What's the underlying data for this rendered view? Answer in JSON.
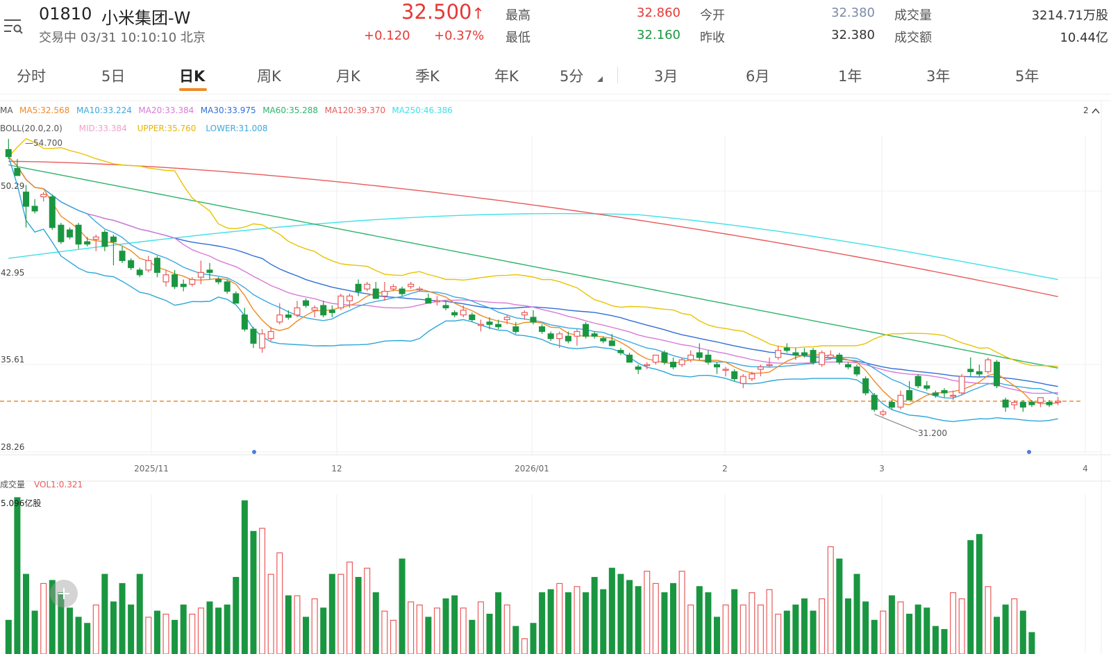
{
  "stock": {
    "code": "01810",
    "name": "小米集团-W",
    "status": "交易中 03/31 10:10:10 北京",
    "price": "32.500",
    "arrow": "↑",
    "change": "+0.120",
    "change_pct": "+0.37%"
  },
  "quote": [
    {
      "label": "最高",
      "value": "32.860",
      "color": "#e53935"
    },
    {
      "label": "最低",
      "value": "32.160",
      "color": "#1a9641"
    },
    {
      "label": "今开",
      "value": "32.380",
      "color": "#7a8aa8"
    },
    {
      "label": "昨收",
      "value": "32.380",
      "color": "#333333"
    },
    {
      "label": "成交量",
      "value": "3214.71万股",
      "color": "#333333"
    },
    {
      "label": "成交额",
      "value": "10.44亿",
      "color": "#333333"
    }
  ],
  "tabs": [
    "分时",
    "5日",
    "日K",
    "周K",
    "月K",
    "季K",
    "年K",
    "5分",
    "3月",
    "6月",
    "1年",
    "3年",
    "5年"
  ],
  "active_tab": "日K",
  "indicators": {
    "ma": [
      {
        "text": "MA",
        "color": "#555555"
      },
      {
        "text": "MA5:32.568",
        "color": "#f08a24"
      },
      {
        "text": "MA10:33.224",
        "color": "#3aa8e0"
      },
      {
        "text": "MA20:33.384",
        "color": "#d77ad8"
      },
      {
        "text": "MA30:33.975",
        "color": "#2f6fd6"
      },
      {
        "text": "MA60:35.288",
        "color": "#2db36a"
      },
      {
        "text": "MA120:39.370",
        "color": "#e85a5a"
      },
      {
        "text": "MA250:46.386",
        "color": "#3ee0e8"
      }
    ],
    "boll": [
      {
        "text": "BOLL(20.0,2.0)",
        "color": "#555555"
      },
      {
        "text": "MID:33.384",
        "color": "#f2a0c8"
      },
      {
        "text": "UPPER:35.760",
        "color": "#e8b400"
      },
      {
        "text": "LOWER:31.008",
        "color": "#3aa8e0"
      }
    ],
    "multiplier": "2",
    "vol": [
      {
        "text": "成交量",
        "color": "#555555"
      },
      {
        "text": "VOL1:0.321",
        "color": "#e85a5a"
      }
    ]
  },
  "chart_data": {
    "type": "candlestick",
    "y_ticks": [
      "50.29",
      "42.95",
      "35.61",
      "28.26"
    ],
    "x_ticks": [
      "2025/11",
      "12",
      "2026/01",
      "2",
      "3",
      "4"
    ],
    "ylim": [
      28.26,
      55.0
    ],
    "max_label": "54.700",
    "min_label": "31.200",
    "current_price": 32.5,
    "vol_max_label": "5.096亿股",
    "vol_max": 5.096,
    "candles": [
      [
        53.8,
        54.7,
        53.0,
        53.2
      ],
      [
        52.2,
        53.0,
        51.6,
        51.6
      ],
      [
        50.2,
        50.8,
        47.2,
        49.0
      ],
      [
        49.0,
        49.6,
        48.4,
        48.6
      ],
      [
        49.8,
        50.2,
        49.4,
        50.0
      ],
      [
        49.8,
        50.0,
        47.0,
        47.2
      ],
      [
        47.4,
        47.6,
        45.8,
        46.0
      ],
      [
        47.0,
        47.2,
        46.2,
        46.4
      ],
      [
        47.4,
        47.6,
        45.4,
        45.8
      ],
      [
        46.0,
        46.4,
        45.6,
        45.8
      ],
      [
        46.2,
        46.6,
        45.2,
        46.4
      ],
      [
        46.8,
        47.0,
        45.2,
        45.6
      ],
      [
        46.4,
        46.6,
        44.0,
        46.0
      ],
      [
        45.2,
        45.6,
        44.2,
        44.4
      ],
      [
        44.4,
        44.6,
        43.6,
        43.8
      ],
      [
        43.6,
        43.8,
        43.0,
        43.2
      ],
      [
        43.6,
        44.8,
        43.4,
        44.4
      ],
      [
        44.6,
        44.8,
        43.0,
        43.4
      ],
      [
        42.6,
        43.6,
        42.2,
        43.2
      ],
      [
        43.2,
        43.6,
        42.0,
        42.2
      ],
      [
        42.4,
        42.8,
        41.8,
        42.2
      ],
      [
        42.4,
        43.0,
        42.2,
        42.8
      ],
      [
        43.0,
        44.4,
        42.4,
        43.4
      ],
      [
        43.6,
        44.2,
        42.8,
        43.4
      ],
      [
        42.8,
        43.0,
        42.4,
        42.6
      ],
      [
        42.6,
        42.8,
        41.6,
        41.8
      ],
      [
        41.6,
        41.8,
        40.8,
        40.8
      ],
      [
        39.8,
        40.4,
        38.4,
        38.6
      ],
      [
        38.6,
        38.8,
        37.0,
        37.4
      ],
      [
        37.0,
        38.6,
        36.6,
        38.2
      ],
      [
        37.8,
        38.8,
        37.6,
        38.4
      ],
      [
        39.2,
        40.8,
        39.0,
        39.8
      ],
      [
        39.8,
        40.2,
        39.4,
        39.6
      ],
      [
        39.8,
        41.0,
        39.6,
        40.4
      ],
      [
        41.0,
        41.2,
        40.4,
        40.6
      ],
      [
        40.2,
        40.6,
        39.6,
        40.4
      ],
      [
        40.6,
        41.0,
        39.6,
        39.8
      ],
      [
        40.2,
        40.6,
        39.6,
        40.0
      ],
      [
        40.4,
        41.6,
        40.2,
        41.4
      ],
      [
        41.0,
        41.6,
        40.4,
        41.4
      ],
      [
        42.4,
        42.8,
        41.4,
        41.8
      ],
      [
        42.0,
        42.6,
        41.8,
        42.4
      ],
      [
        42.0,
        42.6,
        41.2,
        41.2
      ],
      [
        41.4,
        42.6,
        41.0,
        41.8
      ],
      [
        42.0,
        42.4,
        41.8,
        42.2
      ],
      [
        42.0,
        42.2,
        41.4,
        41.6
      ],
      [
        42.2,
        42.6,
        42.0,
        42.4
      ],
      [
        42.0,
        42.2,
        41.8,
        42.0
      ],
      [
        41.2,
        41.6,
        40.8,
        40.8
      ],
      [
        41.0,
        41.4,
        40.6,
        41.0
      ],
      [
        40.6,
        41.0,
        40.2,
        40.4
      ],
      [
        40.0,
        40.2,
        39.6,
        39.8
      ],
      [
        39.8,
        40.6,
        39.6,
        40.2
      ],
      [
        39.8,
        40.0,
        39.2,
        39.4
      ],
      [
        39.0,
        39.4,
        38.4,
        39.0
      ],
      [
        39.2,
        39.6,
        38.6,
        39.0
      ],
      [
        39.0,
        39.4,
        38.6,
        38.8
      ],
      [
        39.4,
        39.8,
        39.0,
        39.6
      ],
      [
        38.8,
        39.2,
        38.2,
        38.4
      ],
      [
        39.8,
        40.2,
        39.4,
        40.0
      ],
      [
        39.6,
        40.2,
        39.0,
        39.2
      ],
      [
        38.8,
        39.0,
        38.2,
        38.4
      ],
      [
        38.2,
        38.4,
        37.6,
        37.8
      ],
      [
        37.8,
        38.4,
        37.0,
        38.2
      ],
      [
        38.0,
        38.4,
        37.4,
        37.6
      ],
      [
        38.0,
        38.6,
        37.2,
        38.4
      ],
      [
        39.0,
        39.2,
        37.8,
        38.0
      ],
      [
        38.2,
        38.4,
        37.8,
        38.0
      ],
      [
        37.8,
        38.0,
        37.4,
        37.6
      ],
      [
        37.6,
        38.2,
        37.4,
        37.2
      ],
      [
        36.8,
        37.0,
        36.4,
        36.6
      ],
      [
        36.4,
        36.6,
        35.8,
        35.8
      ],
      [
        35.4,
        35.6,
        34.8,
        35.2
      ],
      [
        35.6,
        35.8,
        35.2,
        35.6
      ],
      [
        35.8,
        36.4,
        35.6,
        36.4
      ],
      [
        36.6,
        36.8,
        35.6,
        35.8
      ],
      [
        35.8,
        36.2,
        35.2,
        35.4
      ],
      [
        35.6,
        36.2,
        35.4,
        36.0
      ],
      [
        36.0,
        36.8,
        35.8,
        36.4
      ],
      [
        36.6,
        37.4,
        36.0,
        36.2
      ],
      [
        36.4,
        36.8,
        35.6,
        35.8
      ],
      [
        35.6,
        35.8,
        34.8,
        35.4
      ],
      [
        35.2,
        35.4,
        34.6,
        35.2
      ],
      [
        35.0,
        35.2,
        34.2,
        34.4
      ],
      [
        34.0,
        34.8,
        33.6,
        34.6
      ],
      [
        34.4,
        35.0,
        34.2,
        34.8
      ],
      [
        35.2,
        35.6,
        34.6,
        35.4
      ],
      [
        35.6,
        36.2,
        35.4,
        35.6
      ],
      [
        36.2,
        37.2,
        36.0,
        36.8
      ],
      [
        37.0,
        37.4,
        36.6,
        36.8
      ],
      [
        36.6,
        37.0,
        36.0,
        36.4
      ],
      [
        36.6,
        37.0,
        36.2,
        36.4
      ],
      [
        36.8,
        37.0,
        35.6,
        35.8
      ],
      [
        35.6,
        36.8,
        35.4,
        36.6
      ],
      [
        36.2,
        36.8,
        36.0,
        36.4
      ],
      [
        36.4,
        36.6,
        35.6,
        35.8
      ],
      [
        35.6,
        35.8,
        35.2,
        35.4
      ],
      [
        35.4,
        35.6,
        34.6,
        34.8
      ],
      [
        34.4,
        34.6,
        33.0,
        33.2
      ],
      [
        33.0,
        33.2,
        31.6,
        31.8
      ],
      [
        31.4,
        31.8,
        31.2,
        31.6
      ],
      [
        32.4,
        32.6,
        31.8,
        32.0
      ],
      [
        32.0,
        33.4,
        31.8,
        33.0
      ],
      [
        33.4,
        34.2,
        33.0,
        32.6
      ],
      [
        34.6,
        34.8,
        33.6,
        33.8
      ],
      [
        33.8,
        34.2,
        33.4,
        33.6
      ],
      [
        33.2,
        33.4,
        32.8,
        33.0
      ],
      [
        33.4,
        33.6,
        32.8,
        33.2
      ],
      [
        33.0,
        33.4,
        32.6,
        33.0
      ],
      [
        33.2,
        34.8,
        33.0,
        34.6
      ],
      [
        35.2,
        36.2,
        34.6,
        35.0
      ],
      [
        35.0,
        35.6,
        34.6,
        34.8
      ],
      [
        35.0,
        36.2,
        34.8,
        36.0
      ],
      [
        35.8,
        36.0,
        33.6,
        33.8
      ],
      [
        32.6,
        32.8,
        31.6,
        32.0
      ],
      [
        32.2,
        32.6,
        31.8,
        32.4
      ],
      [
        32.4,
        32.6,
        31.6,
        32.0
      ],
      [
        32.4,
        32.6,
        32.0,
        32.2
      ],
      [
        32.4,
        32.8,
        32.0,
        32.8
      ],
      [
        32.4,
        32.6,
        32.0,
        32.2
      ],
      [
        32.4,
        32.86,
        32.16,
        32.5
      ]
    ],
    "volume": [
      1.1,
      5.1,
      2.6,
      1.4,
      2.3,
      2.4,
      2.0,
      1.5,
      1.2,
      1.0,
      1.6,
      2.6,
      1.7,
      2.3,
      1.6,
      2.6,
      1.2,
      1.4,
      1.3,
      1.1,
      1.6,
      1.3,
      1.5,
      1.7,
      1.5,
      1.6,
      2.5,
      5.0,
      4.0,
      4.1,
      2.6,
      3.3,
      1.9,
      1.9,
      1.2,
      1.8,
      1.5,
      2.6,
      2.6,
      3.0,
      2.5,
      2.8,
      2.0,
      1.4,
      1.1,
      3.1,
      1.7,
      1.6,
      1.2,
      1.5,
      1.8,
      1.9,
      1.5,
      1.1,
      1.7,
      1.3,
      2.0,
      1.6,
      0.9,
      0.5,
      1.0,
      2.0,
      2.1,
      2.3,
      2.0,
      2.2,
      2.0,
      2.5,
      2.1,
      2.8,
      2.6,
      2.4,
      2.2,
      2.7,
      2.3,
      2.0,
      2.3,
      2.7,
      1.6,
      2.2,
      2.0,
      1.2,
      1.6,
      2.1,
      1.6,
      2.0,
      1.6,
      2.1,
      1.3,
      1.4,
      1.6,
      1.8,
      1.4,
      1.8,
      3.5,
      3.1,
      1.8,
      2.6,
      1.7,
      1.1,
      1.4,
      1.9,
      1.7,
      1.3,
      1.6,
      1.5,
      0.9,
      0.8,
      2.0,
      1.8,
      3.7,
      3.9,
      2.2,
      1.2,
      1.6,
      1.8,
      1.4,
      0.7
    ]
  }
}
